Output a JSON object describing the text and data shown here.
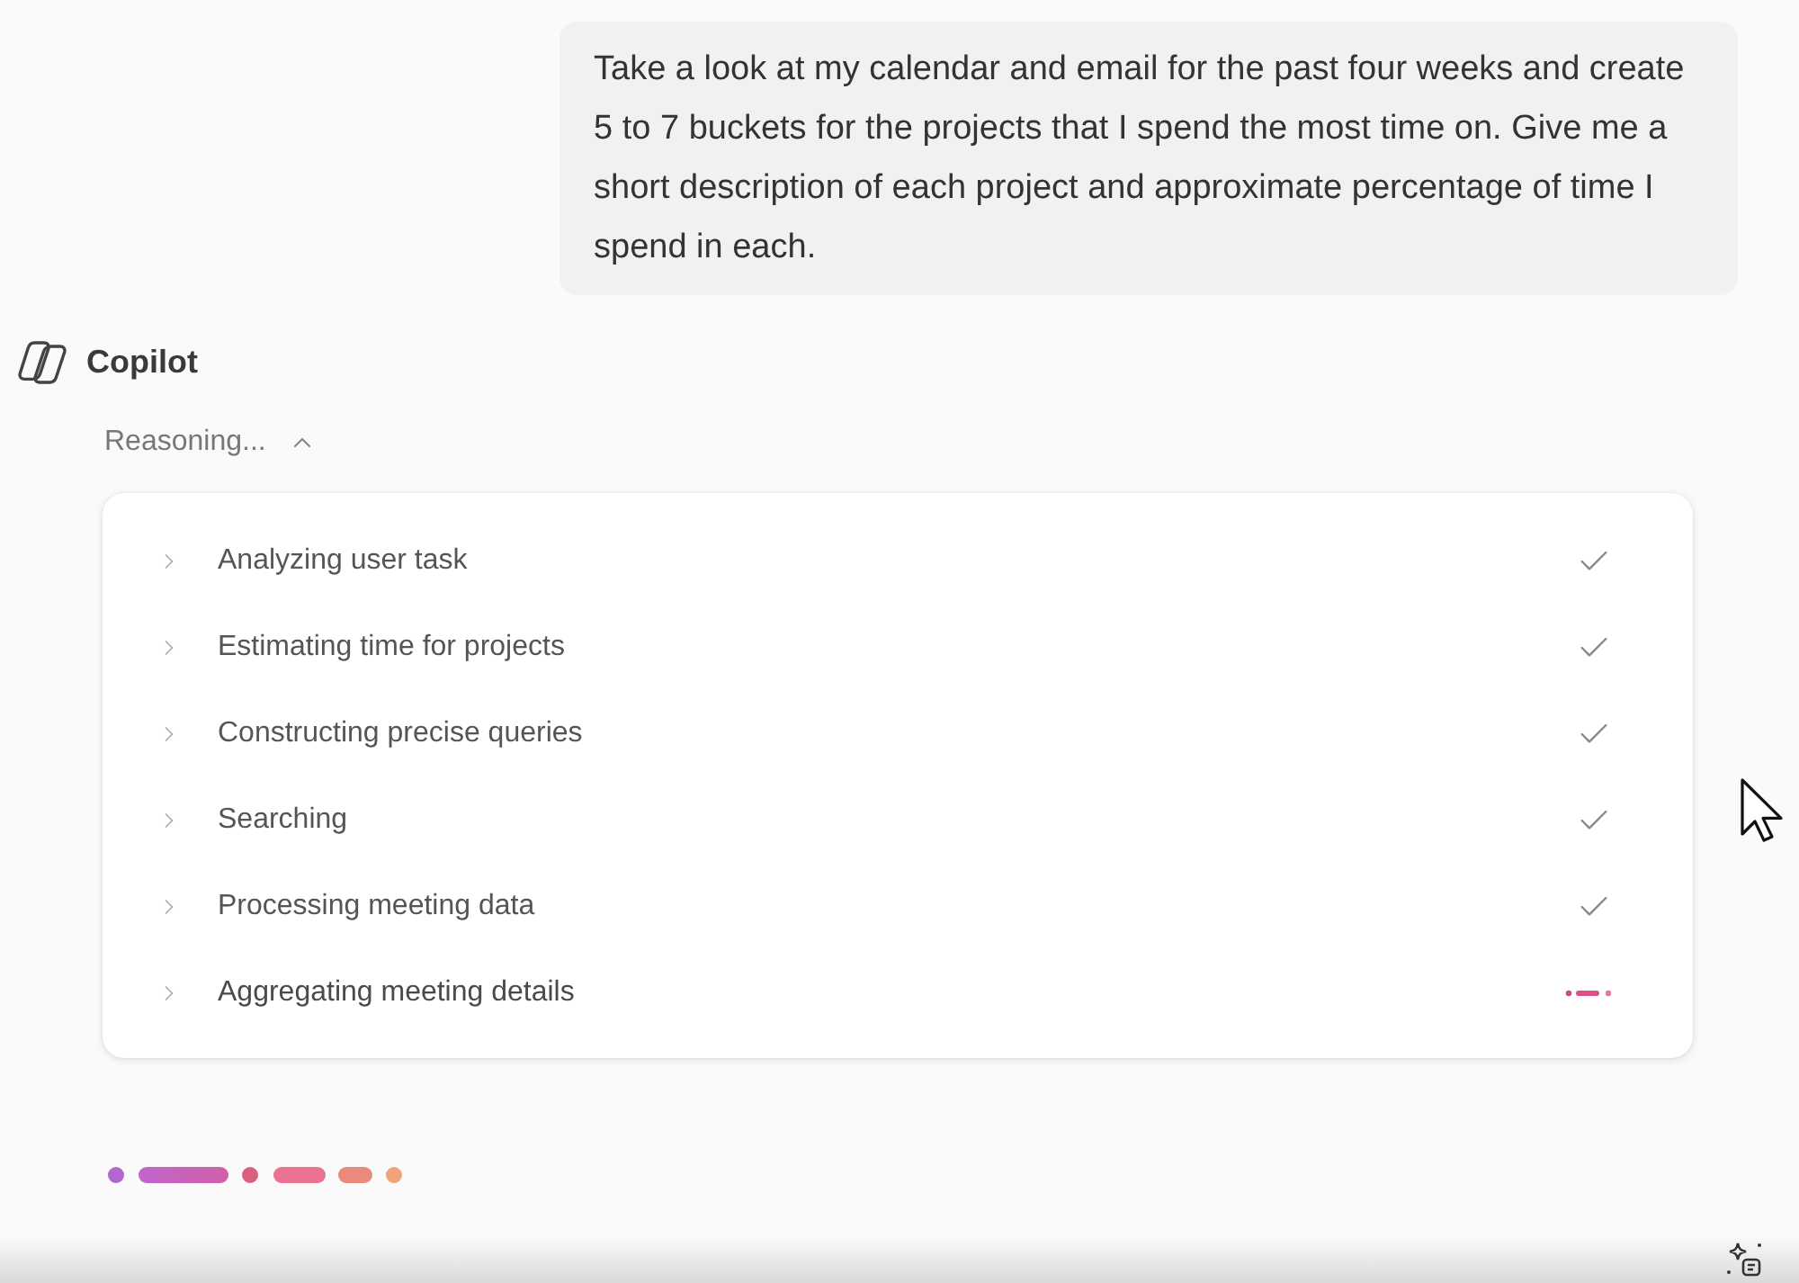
{
  "user_message": {
    "text": "Take a look at my calendar and email for the past four weeks and create 5 to 7 buckets for the projects that I spend the most time on. Give me a short description of each project and approximate percentage of time I spend in each."
  },
  "assistant": {
    "name": "Copilot"
  },
  "reasoning": {
    "label": "Reasoning...",
    "expanded": true,
    "steps": [
      {
        "label": "Analyzing user task",
        "done": true
      },
      {
        "label": "Estimating time for projects",
        "done": true
      },
      {
        "label": "Constructing precise queries",
        "done": true
      },
      {
        "label": "Searching",
        "done": true
      },
      {
        "label": "Processing meeting data",
        "done": true
      },
      {
        "label": "Aggregating meeting details",
        "done": false
      }
    ]
  }
}
